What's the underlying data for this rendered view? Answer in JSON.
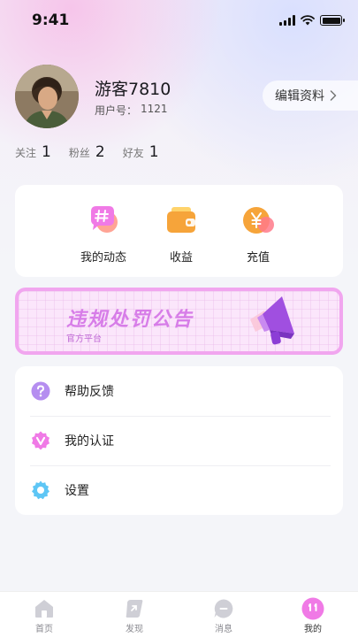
{
  "status_bar": {
    "time": "9:41"
  },
  "profile": {
    "username": "游客7810",
    "user_id_label": "用户号：",
    "user_id": "1121",
    "edit_label": "编辑资料"
  },
  "stats": [
    {
      "label": "关注",
      "value": "1"
    },
    {
      "label": "粉丝",
      "value": "2"
    },
    {
      "label": "好友",
      "value": "1"
    }
  ],
  "actions": [
    {
      "label": "我的动态",
      "icon": "hashtag-chat-icon"
    },
    {
      "label": "收益",
      "icon": "wallet-icon"
    },
    {
      "label": "充值",
      "icon": "yuan-coin-icon"
    }
  ],
  "banner": {
    "title": "违规处罚公告",
    "subtitle": "官方平台"
  },
  "menu": [
    {
      "label": "帮助反馈",
      "icon": "question-icon"
    },
    {
      "label": "我的认证",
      "icon": "verified-icon"
    },
    {
      "label": "设置",
      "icon": "gear-icon"
    }
  ],
  "tabs": [
    {
      "label": "首页",
      "icon": "home-icon"
    },
    {
      "label": "发现",
      "icon": "discover-icon"
    },
    {
      "label": "消息",
      "icon": "message-icon"
    },
    {
      "label": "我的",
      "icon": "profile-icon"
    }
  ],
  "colors": {
    "accent": "#f07ae6",
    "purple": "#b58ef0",
    "banner_border": "#f1a6ef",
    "banner_text": "#d77de8"
  }
}
